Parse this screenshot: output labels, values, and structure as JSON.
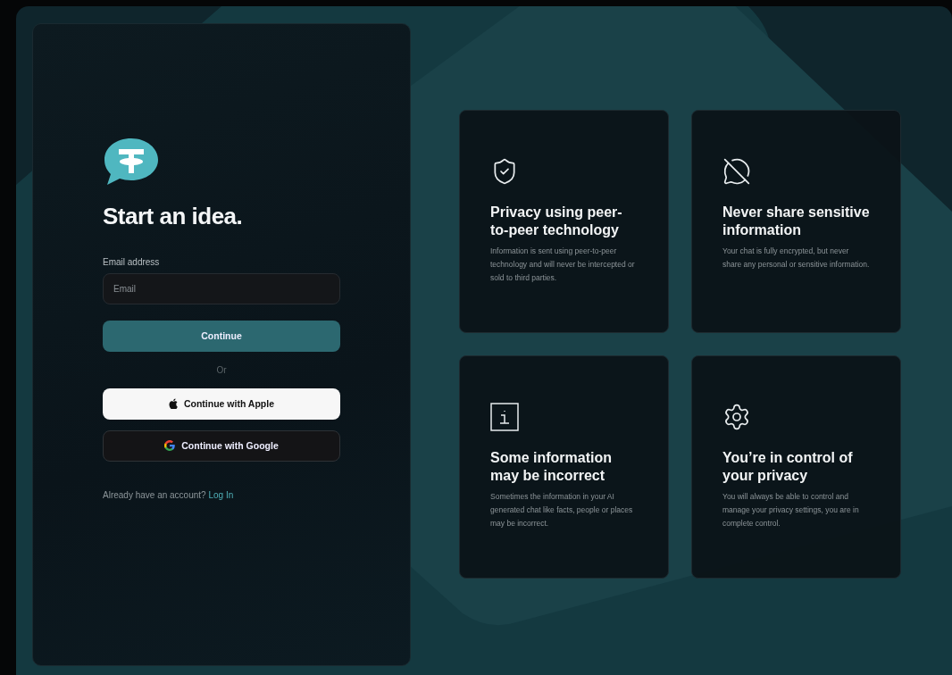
{
  "login": {
    "heading": "Start an idea.",
    "email_label": "Email address",
    "email_placeholder": "Email",
    "continue_button": "Continue",
    "divider": "Or",
    "providers": [
      {
        "kind": "apple",
        "label": "Continue with Apple"
      },
      {
        "kind": "google",
        "label": "Continue with Google"
      }
    ],
    "account_prompt": "Already have an account?",
    "login_link": "Log In"
  },
  "features": [
    {
      "kind": "shield",
      "title": "Privacy using peer-to-peer technology",
      "text": "Information is sent using peer-to-peer technology and will never be intercepted or sold to third parties."
    },
    {
      "kind": "chat-off",
      "title": "Never share sensitive information",
      "text": "Your chat is fully encrypted, but never share any personal or sensitive information."
    },
    {
      "kind": "info",
      "title": "Some information may be incorrect",
      "text": "Sometimes the information in your AI generated chat like facts, people or places may be incorrect."
    },
    {
      "kind": "gear",
      "title": "You’re in control of your privacy",
      "text": "You will always be able to control and manage your privacy settings, you are in complete control."
    }
  ]
}
